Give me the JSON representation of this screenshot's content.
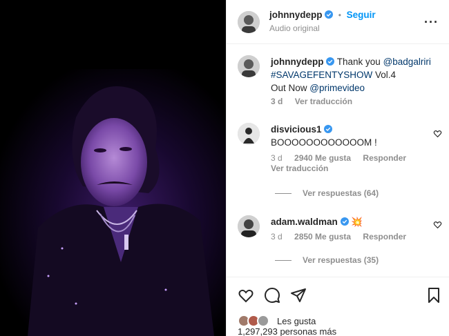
{
  "media": {
    "description_icon": "post-photo"
  },
  "header": {
    "username": "johnnydepp",
    "follow_label": "Seguir",
    "audio_label": "Audio original",
    "more_icon": "more-icon"
  },
  "caption": {
    "username": "johnnydepp",
    "text_1": "Thank you ",
    "mention_1": "@badgalriri",
    "hashtag": "#SAVAGEFENTYSHOW",
    "text_2": " Vol.4",
    "text_3": "Out Now ",
    "mention_2": "@primevideo",
    "time": "3 d",
    "translate": "Ver traducción"
  },
  "comments": [
    {
      "username": "disvicious1",
      "text": "BOOOOOOOOOOOOM !",
      "time": "3 d",
      "likes": "2940 Me gusta",
      "reply": "Responder",
      "translate": "Ver traducción",
      "view_replies": "Ver respuestas (64)"
    },
    {
      "username": "adam.waldman",
      "text": "💥",
      "time": "3 d",
      "likes": "2850 Me gusta",
      "reply": "Responder",
      "view_replies": "Ver respuestas (35)"
    }
  ],
  "likes": {
    "text": "Les gusta",
    "count": "1,297,293 personas más"
  },
  "colors": {
    "accent": "#0095f6",
    "verified": "#3897f0"
  }
}
